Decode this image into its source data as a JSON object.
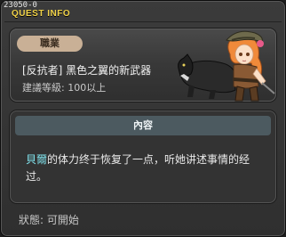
{
  "window": {
    "quest_id": "23050-0",
    "title": "QUEST INFO"
  },
  "header": {
    "job_badge": "職業",
    "quest_name": "[反抗者] 黑色之翼的新武器",
    "level_label": "建議等級",
    "level_separator": ":",
    "level_value": "100以上"
  },
  "content": {
    "header": "內容",
    "npc_name": "貝爾",
    "text": "的体力终于恢复了一点，听她讲述事情的经过。"
  },
  "status": {
    "label": "狀態",
    "separator": ":",
    "value": "可開始"
  },
  "colors": {
    "title": "#f0d248",
    "badge_bg": "#c9b096",
    "npc_highlight": "#7fe0ea",
    "content_header_bg": "#4c5a60"
  },
  "icons": {
    "portrait": "quest-npc-portrait-icon"
  }
}
